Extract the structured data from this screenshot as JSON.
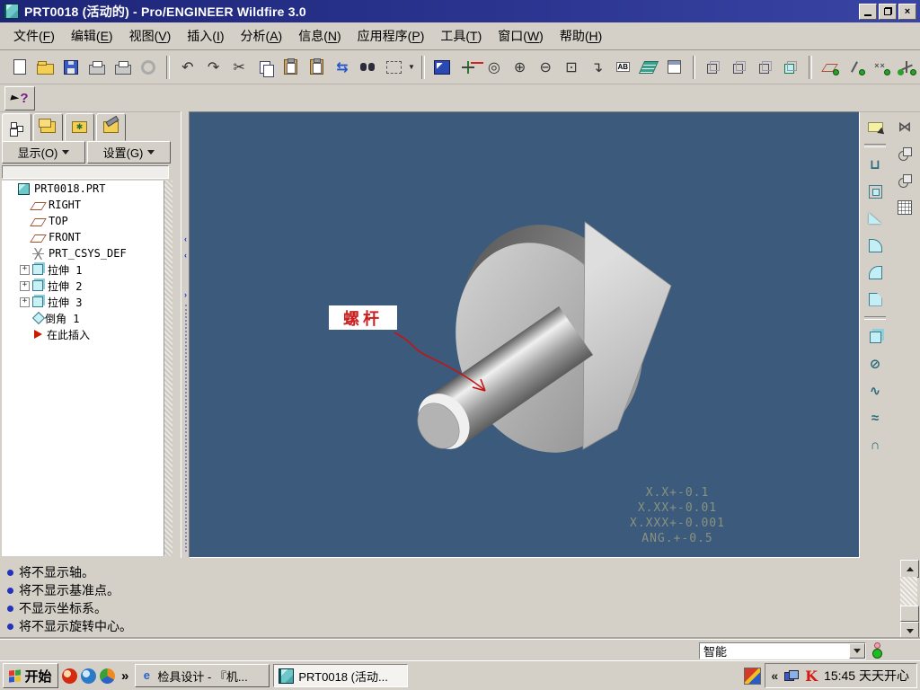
{
  "window": {
    "title": "PRT0018 (活动的) - Pro/ENGINEER Wildfire 3.0"
  },
  "menu": [
    "文件(F)",
    "编辑(E)",
    "视图(V)",
    "插入(I)",
    "分析(A)",
    "信息(N)",
    "应用程序(P)",
    "工具(T)",
    "窗口(W)",
    "帮助(H)"
  ],
  "icons": {
    "undo": "↶",
    "redo": "↷",
    "cut": "✂",
    "regenerate": "⇆",
    "zoom_in": "⊕",
    "zoom_out": "⊖",
    "refit": "⊡",
    "orient": "◎",
    "saved_views": "↴",
    "named_views": "AB",
    "help_question": "?",
    "hole_tool": "⊔",
    "revolve_tool": "⊘",
    "sweep_tool": "∿",
    "blend_tool": "≈",
    "style_tool": "∩",
    "merge_tool": "⋈",
    "quick_launch_chevron": "»",
    "tray_chevron": "«",
    "close": "×"
  },
  "left_panel": {
    "show_button": "显示(O)",
    "settings_button": "设置(G)",
    "tree": [
      {
        "label": "PRT0018.PRT",
        "icon": "part",
        "indent": 0,
        "expand": false
      },
      {
        "label": "RIGHT",
        "icon": "plane",
        "indent": 1,
        "expand": false
      },
      {
        "label": "TOP",
        "icon": "plane",
        "indent": 1,
        "expand": false
      },
      {
        "label": "FRONT",
        "icon": "plane",
        "indent": 1,
        "expand": false
      },
      {
        "label": "PRT_CSYS_DEF",
        "icon": "csys",
        "indent": 1,
        "expand": false
      },
      {
        "label": "拉伸 1",
        "icon": "extrude",
        "indent": 1,
        "expand": true
      },
      {
        "label": "拉伸 2",
        "icon": "extrude",
        "indent": 1,
        "expand": true
      },
      {
        "label": "拉伸 3",
        "icon": "extrude",
        "indent": 1,
        "expand": true
      },
      {
        "label": "倒角 1",
        "icon": "chamfer",
        "indent": 1,
        "expand": false
      },
      {
        "label": "在此插入",
        "icon": "insert",
        "indent": 1,
        "expand": false
      }
    ]
  },
  "viewport": {
    "annotation_label": "螺杆",
    "tolerances": [
      "X.X+-0.1",
      "X.XX+-0.01",
      "X.XXX+-0.001",
      "ANG.+-0.5"
    ],
    "background_color": "#3c5a7c",
    "annotation_color": "#cc2020"
  },
  "messages": [
    "将不显示轴。",
    "将不显示基准点。",
    "不显示坐标系。",
    "将不显示旋转中心。"
  ],
  "status_bar": {
    "selection_filter": "智能"
  },
  "taskbar": {
    "start_label": "开始",
    "tasks": [
      {
        "label": "检具设计 - 『机...",
        "active": false
      },
      {
        "label": "PRT0018 (活动...",
        "active": true
      }
    ],
    "ie_glyph": "e",
    "clock": "15:45 天天开心"
  }
}
